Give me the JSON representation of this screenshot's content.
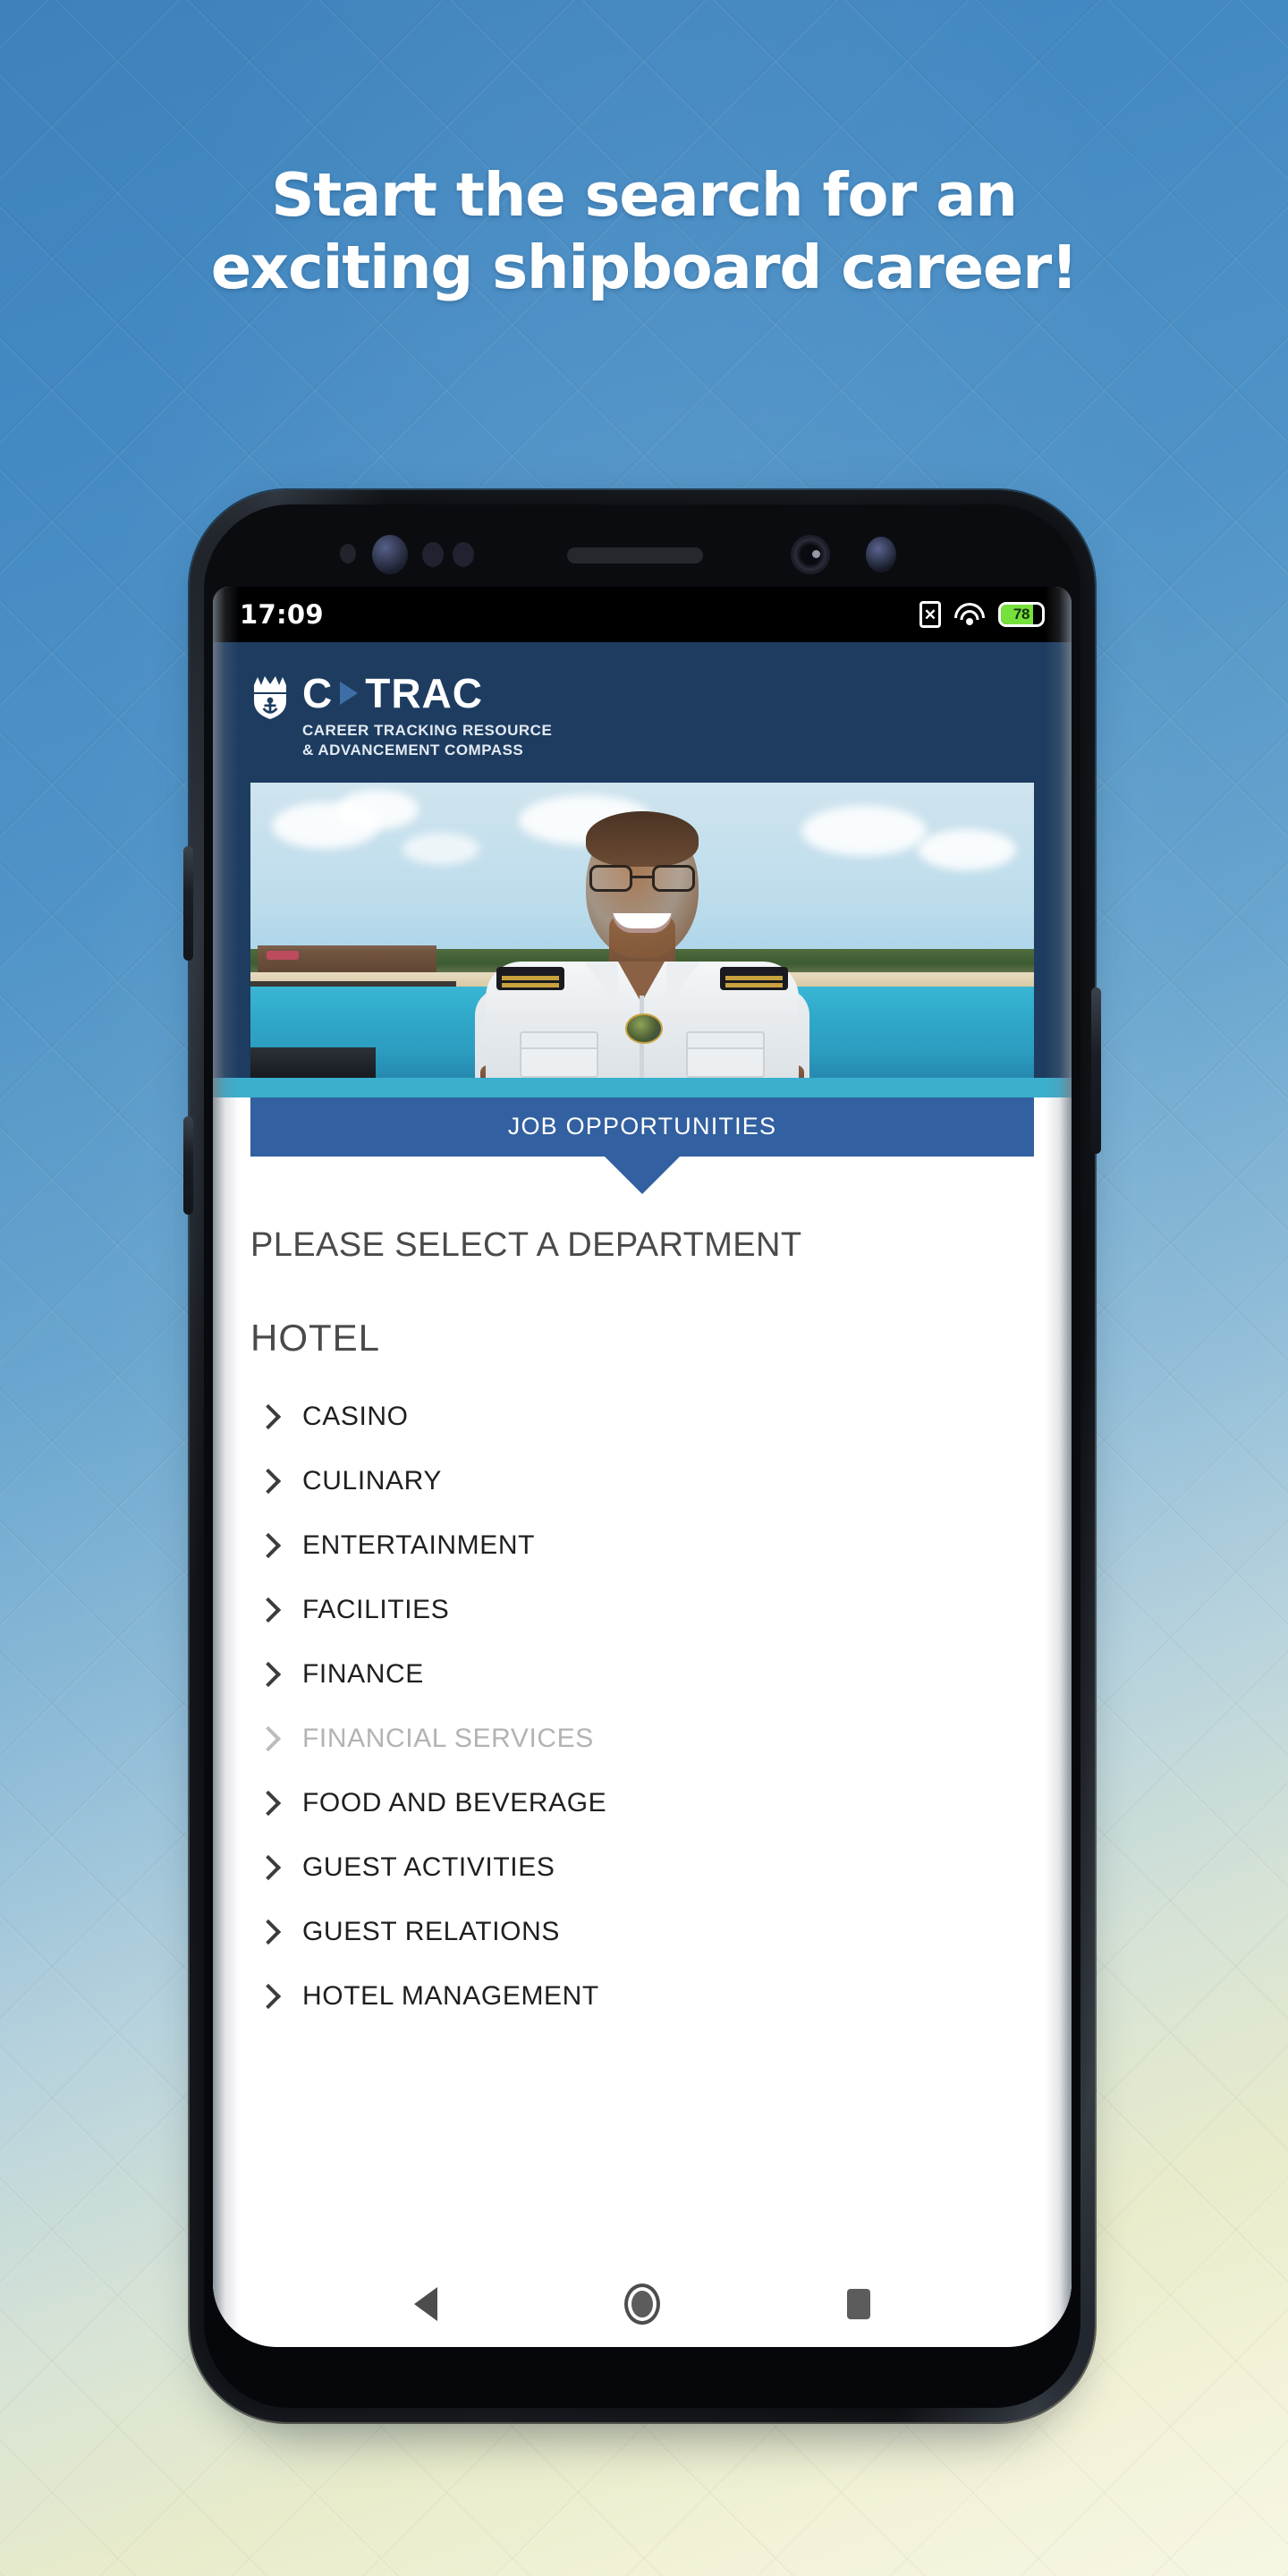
{
  "poster": {
    "headline_line1": "Start the search for an",
    "headline_line2": "exciting shipboard career!",
    "colors": {
      "bg_top": "#3e82bb",
      "bg_bottom": "#f7f6e4",
      "headline_color": "#ffffff"
    }
  },
  "phone": {
    "statusbar": {
      "time": "17:09",
      "nosim_glyph": "✕",
      "battery_level": "78",
      "battery_percent": 78,
      "battery_color": "#76e03c",
      "icons": [
        "no-sim-icon",
        "wifi-icon",
        "battery-icon"
      ]
    },
    "navbar": {
      "back_label": "Back",
      "home_label": "Home",
      "recents_label": "Recents"
    }
  },
  "app": {
    "header": {
      "logo_icon": "crown-and-anchor-icon",
      "wordmark_c": "C",
      "wordmark_separator_icon": "play-triangle-icon",
      "wordmark_trac": "TRAC",
      "tagline_line1": "CAREER TRACKING RESOURCE",
      "tagline_line2": "& ADVANCEMENT COMPASS",
      "bg_color": "#1d3c60",
      "accent_band_color": "#3bafce"
    },
    "hero": {
      "alt": "Smiling shipboard officer in white uniform at a tropical port"
    },
    "banner": {
      "label": "JOB OPPORTUNITIES",
      "bg_color": "#3260a0"
    },
    "content": {
      "instruction": "PLEASE SELECT A DEPARTMENT",
      "group_title": "HOTEL",
      "departments": [
        {
          "label": "CASINO",
          "disabled": false
        },
        {
          "label": "CULINARY",
          "disabled": false
        },
        {
          "label": "ENTERTAINMENT",
          "disabled": false
        },
        {
          "label": "FACILITIES",
          "disabled": false
        },
        {
          "label": "FINANCE",
          "disabled": false
        },
        {
          "label": "FINANCIAL SERVICES",
          "disabled": true
        },
        {
          "label": "FOOD AND BEVERAGE",
          "disabled": false
        },
        {
          "label": "GUEST ACTIVITIES",
          "disabled": false
        },
        {
          "label": "GUEST RELATIONS",
          "disabled": false
        },
        {
          "label": "HOTEL MANAGEMENT",
          "disabled": false
        }
      ]
    }
  }
}
